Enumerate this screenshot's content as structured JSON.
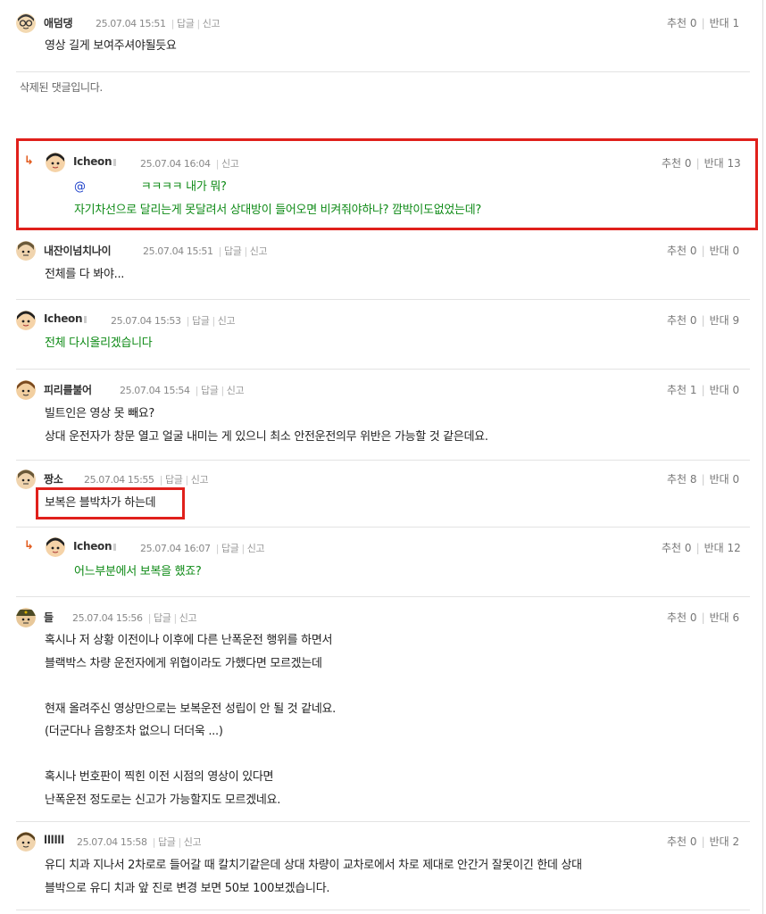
{
  "ui": {
    "reply_label": "답글",
    "report_label": "신고",
    "like_label": "추천",
    "dislike_label": "반대",
    "reply_arrow": "↳"
  },
  "comments": [
    {
      "nick": "애덤댕",
      "date": "25.07.04 15:51",
      "likes": "0",
      "dislikes": "1",
      "lines": [
        "영상 길게 보여주셔야될듯요"
      ]
    },
    {
      "deleted_text": "삭제된 댓글입니다."
    },
    {
      "nick": "Icheon",
      "date": "25.07.04 16:04",
      "likes": "0",
      "dislikes": "13",
      "mention": "@",
      "line1_rest": "ㅋㅋㅋㅋ 내가 뭐?",
      "line2": "자기차선으로 달리는게 못달려서 상대방이 들어오면 비켜줘야하나? 깜박이도없었는데?"
    },
    {
      "nick": "내잔이넘치나이",
      "date": "25.07.04 15:51",
      "likes": "0",
      "dislikes": "0",
      "lines": [
        "전체를 다 봐야..."
      ]
    },
    {
      "nick": "Icheon",
      "date": "25.07.04 15:53",
      "likes": "0",
      "dislikes": "9",
      "lines": [
        "전체 다시올리겠습니다"
      ]
    },
    {
      "nick": "피리를불어",
      "date": "25.07.04 15:54",
      "likes": "1",
      "dislikes": "0",
      "lines": [
        "빌트인은 영상 못 빼요?",
        "상대 운전자가 창문 열고 얼굴 내미는 게 있으니 최소 안전운전의무 위반은 가능할 것 같은데요."
      ]
    },
    {
      "nick": "짱소",
      "date": "25.07.04 15:55",
      "likes": "8",
      "dislikes": "0",
      "lines": [
        "보복은 블박차가 하는데"
      ]
    },
    {
      "nick": "Icheon",
      "date": "25.07.04 16:07",
      "likes": "0",
      "dislikes": "12",
      "lines": [
        "어느부분에서 보복을 했죠?"
      ]
    },
    {
      "nick": "들",
      "date": "25.07.04 15:56",
      "likes": "0",
      "dislikes": "6",
      "lines": [
        "혹시나 저 상황 이전이나 이후에 다른 난폭운전 행위를 하면서",
        "블랙박스 차량 운전자에게 위협이라도 가했다면 모르겠는데",
        "",
        "현재 올려주신 영상만으로는 보복운전 성립이 안 될 것 같네요.",
        "(더군다나 음향조차 없으니 더더욱 ...)",
        "",
        "혹시나 번호판이 찍힌 이전 시점의 영상이 있다면",
        "난폭운전 정도로는 신고가 가능할지도 모르겠네요."
      ]
    },
    {
      "nick": "llllll",
      "date": "25.07.04 15:58",
      "likes": "0",
      "dislikes": "2",
      "lines": [
        "유디 치과 지나서 2차로로 들어갈 때 칼치기같은데 상대 차량이 교차로에서 차로 제대로 안간거 잘못이긴 한데 상대",
        "블박으로 유디 치과 앞 진로 변경 보면 50보 100보겠습니다."
      ]
    }
  ],
  "colors": {
    "accent_red": "#e0201b",
    "reply_green": "#0e8a16",
    "mention_blue": "#1a3ec9",
    "reply_arrow": "#e25a1c"
  },
  "icons": [
    "avatar-icon",
    "reply-arrow-icon"
  ]
}
